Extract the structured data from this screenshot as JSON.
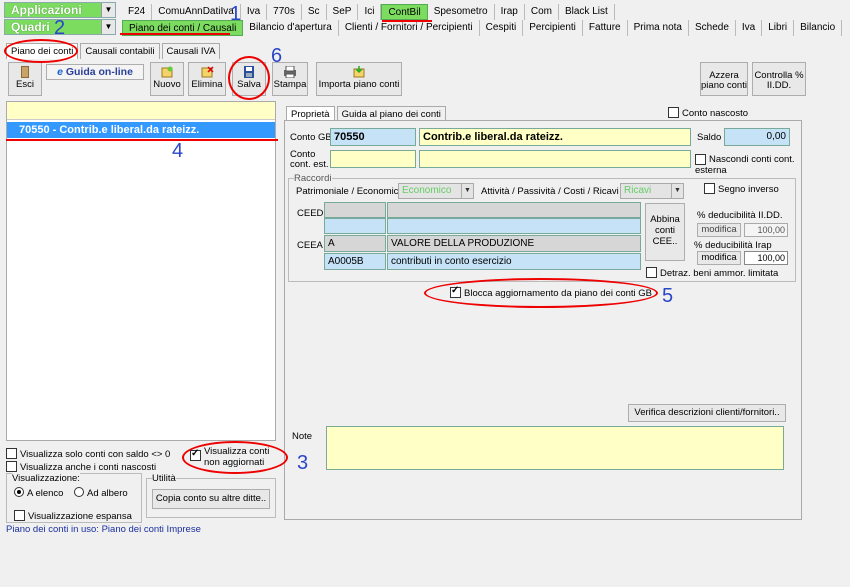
{
  "appbar": {
    "applicazioni": "Applicazioni",
    "quadri": "Quadri",
    "menu1": [
      "F24",
      "ComuAnnDatiIva",
      "Iva",
      "770s",
      "Sc",
      "SeP",
      "Ici",
      "ContBil",
      "Spesometro",
      "Irap",
      "Com",
      "Black List"
    ],
    "menu1_active": "ContBil",
    "menu2": [
      "Piano dei conti / Causali",
      "Bilancio d'apertura",
      "Clienti / Fornitori / Percipienti",
      "Cespiti",
      "Percipienti",
      "Fatture",
      "Prima nota",
      "Schede",
      "Iva",
      "Libri",
      "Bilancio"
    ],
    "menu2_active": "Piano dei conti / Causali"
  },
  "tabs": [
    "Piano dei conti",
    "Causali contabili",
    "Causali IVA"
  ],
  "toolbar": {
    "esci": "Esci",
    "guida": "Guida on-line",
    "nuovo": "Nuovo",
    "elimina": "Elimina",
    "salva": "Salva",
    "stampa": "Stampa",
    "importa": "Importa piano conti",
    "azzera": "Azzera piano conti",
    "controlla": "Controlla % II.DD."
  },
  "list": {
    "selected_item": "70550 - Contrib.e liberal.da rateizz."
  },
  "left_options": {
    "solo_saldo": "Visualizza solo conti con saldo <> 0",
    "nascosti": "Visualizza anche i conti nascosti",
    "non_aggiornati": "Visualizza conti non aggiornati",
    "visualizzazione": "Visualizzazione:",
    "a_elenco": "A elenco",
    "ad_albero": "Ad albero",
    "espansa": "Visualizzazione espansa",
    "utilita": "Utilità",
    "copia": "Copia conto su altre ditte..",
    "footer": "Piano dei conti in uso: Piano dei conti Imprese"
  },
  "detail": {
    "tabs": [
      "Proprietà",
      "Guida al piano dei conti"
    ],
    "conto_nascosto": "Conto nascosto",
    "conto_gb_label": "Conto GB",
    "conto_gb_code": "70550",
    "conto_gb_desc": "Contrib.e liberal.da rateizz.",
    "saldo_label": "Saldo",
    "saldo_value": "0,00",
    "conto_est_label1": "Conto",
    "conto_est_label2": "cont. est.",
    "nascondi": "Nascondi conti cont. esterna",
    "raccordi": "Raccordi",
    "patrimoniale_label": "Patrimoniale / Economico",
    "patrimoniale_value": "Economico",
    "attivita_label": "Attività / Passività / Costi / Ricavi",
    "attivita_value": "Ricavi",
    "segno_inverso": "Segno inverso",
    "ceed": "CEED",
    "ceea": "CEEA",
    "ceea_code1": "A",
    "ceea_desc1": "VALORE DELLA PRODUZIONE",
    "ceea_code2": "A0005B",
    "ceea_desc2": "contributi in conto esercizio",
    "abbina": "Abbina conti CEE..",
    "ded_iidd": "% deducibilità II.DD.",
    "ded_irap": "% deducibilità Irap",
    "modifica": "modifica",
    "ded_iidd_val": "100,00",
    "ded_irap_val": "100,00",
    "detraz": "Detraz. beni ammor. limitata",
    "blocca": "Blocca aggiornamento da piano dei conti GB",
    "verifica": "Verifica descrizioni clienti/fornitori..",
    "note": "Note"
  },
  "annotations": [
    "1",
    "2",
    "3",
    "4",
    "5",
    "6"
  ],
  "colors": {
    "accent_green": "#7bdc60",
    "selection_blue": "#3399ff",
    "annotation_red": "#e00000",
    "annotation_blue": "#2a46c8"
  }
}
